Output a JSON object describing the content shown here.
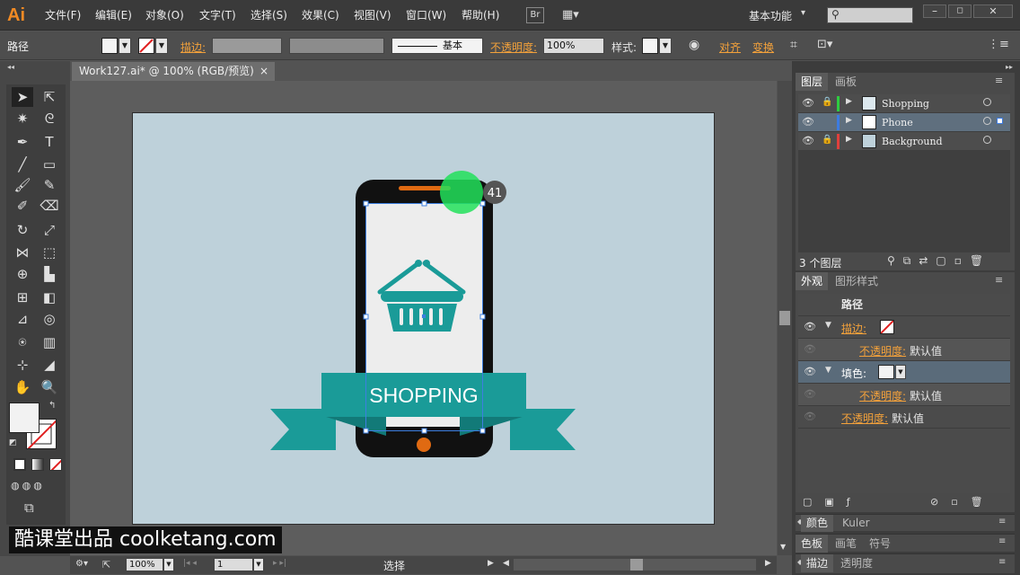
{
  "app": {
    "logo": "Ai",
    "workspace": "基本功能"
  },
  "menu": [
    "文件(F)",
    "编辑(E)",
    "对象(O)",
    "文字(T)",
    "选择(S)",
    "效果(C)",
    "视图(V)",
    "窗口(W)",
    "帮助(H)"
  ],
  "bridge": "Br",
  "control": {
    "object_type": "路径",
    "stroke_label": "描边:",
    "stroke_style": "基本",
    "opacity_label": "不透明度:",
    "opacity_value": "100%",
    "style_label": "样式:",
    "align_label": "对齐",
    "transform_label": "变换"
  },
  "document": {
    "tab_title": "Work127.ai* @ 100% (RGB/预览)",
    "close": "×"
  },
  "artwork": {
    "banner_text": "SHOPPING",
    "badge": "41",
    "colors": {
      "phone": "#111111",
      "screen": "#ededed",
      "teal": "#1a9b98",
      "teal_dark": "#127a78",
      "orange": "#e06a12",
      "highlight": "#22e05a"
    }
  },
  "layers_panel": {
    "tabs": [
      "图层",
      "画板"
    ],
    "layers": [
      {
        "name": "Shopping",
        "color": "#2ecc40"
      },
      {
        "name": "Phone",
        "color": "#3c7be0"
      },
      {
        "name": "Background",
        "color": "#e0403c"
      }
    ],
    "count": "3 个图层"
  },
  "appearance_panel": {
    "tabs": [
      "外观",
      "图形样式"
    ],
    "title": "路径",
    "rows": [
      {
        "label": "描边:",
        "type": "stroke"
      },
      {
        "label": "不透明度:",
        "value": "默认值",
        "indent": true
      },
      {
        "label": "填色:",
        "type": "fill"
      },
      {
        "label": "不透明度:",
        "value": "默认值",
        "indent": true
      },
      {
        "label": "不透明度:",
        "value": "默认值"
      }
    ]
  },
  "collapsed_panels": {
    "color": [
      "颜色",
      "Kuler"
    ],
    "swatches": [
      "色板",
      "画笔",
      "符号"
    ],
    "stroke": [
      "描边",
      "透明度"
    ]
  },
  "status": {
    "zoom": "100%",
    "page": "1",
    "tool": "选择"
  },
  "watermark": "酷课堂出品 coolketang.com"
}
